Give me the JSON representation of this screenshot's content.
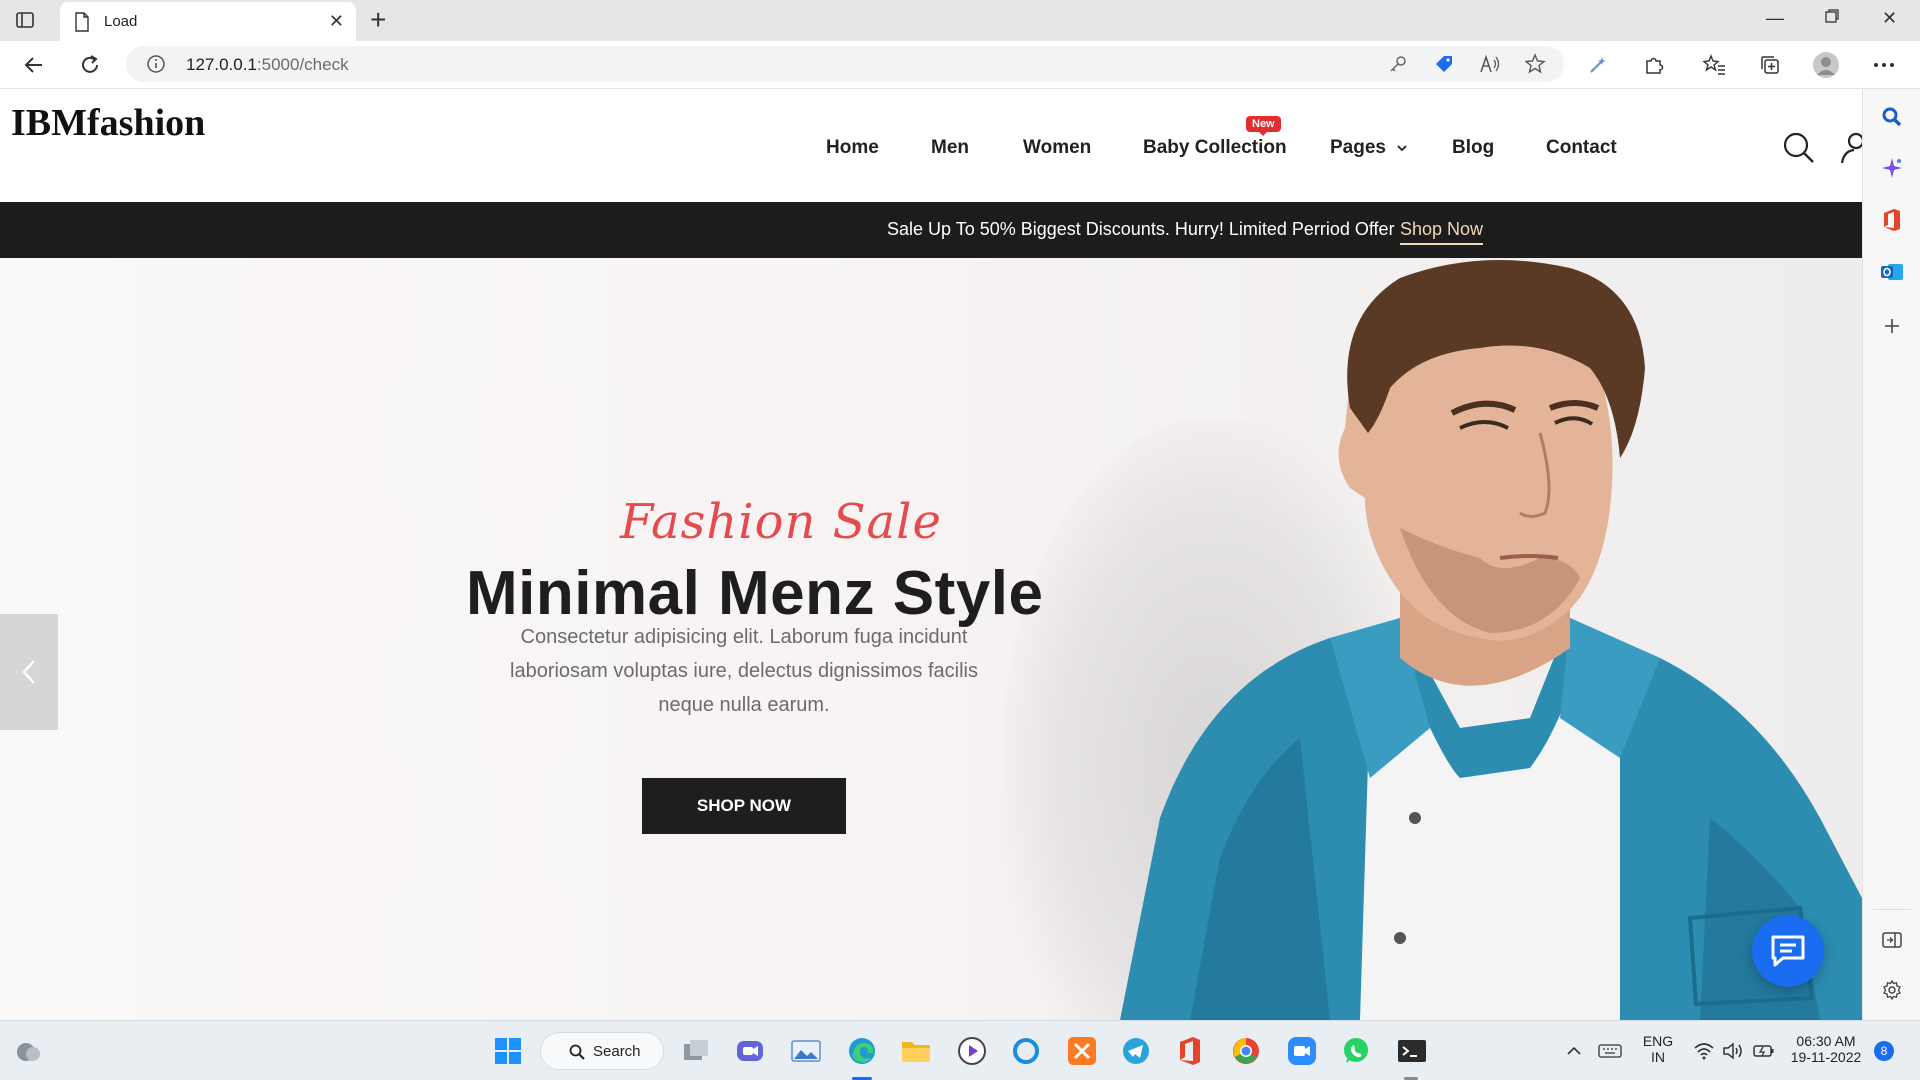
{
  "browser": {
    "tab_title": "Load",
    "url_host": "127.0.0.1",
    "url_rest": ":5000/check"
  },
  "site": {
    "logo": "IBMfashion",
    "nav": [
      "Home",
      "Men",
      "Women",
      "Baby Collection",
      "Pages",
      "Blog",
      "Contact"
    ],
    "new_badge": "New",
    "promo_message": "Sale Up To 50% Biggest Discounts. Hurry! Limited Perriod Offer",
    "promo_link": "Shop Now"
  },
  "hero": {
    "script_title": "Fashion Sale",
    "headline": "Minimal Menz Style",
    "subtext": "Consectetur adipisicing elit. Laborum fuga incidunt laboriosam voluptas iure, delectus dignissimos facilis neque nulla earum.",
    "button": "SHOP NOW"
  },
  "taskbar": {
    "search_label": "Search",
    "lang_line1": "ENG",
    "lang_line2": "IN",
    "time": "06:30 AM",
    "date": "19-11-2022",
    "notification_count": "8"
  },
  "colors": {
    "accent_red": "#e54a4f",
    "promo_bg": "#1c1c1c",
    "chat_blue": "#1a6cf0"
  }
}
